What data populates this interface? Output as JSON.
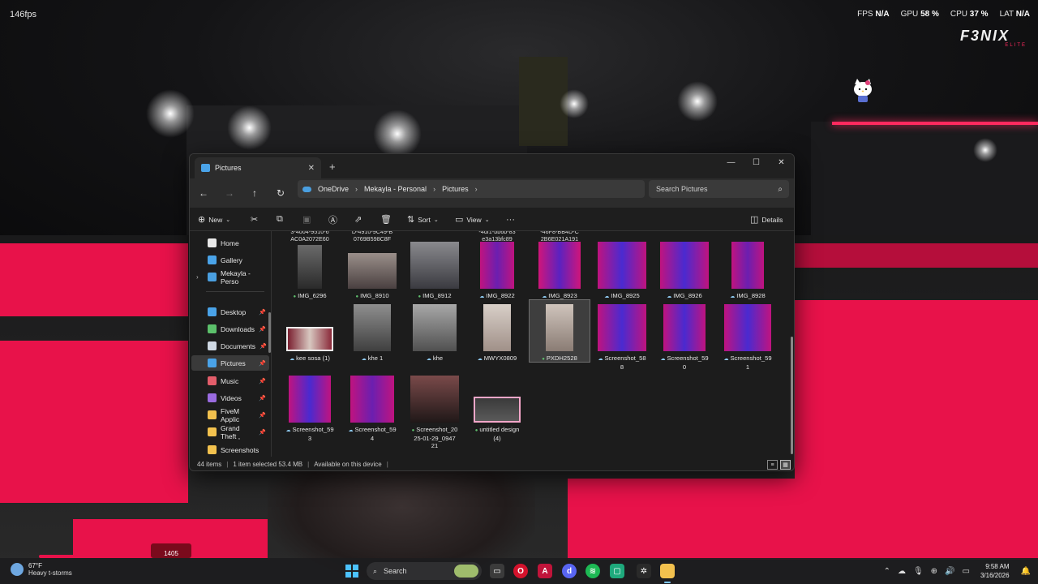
{
  "overlay": {
    "fps_counter": "146fps",
    "fps_label": "FPS",
    "fps_value": "N/A",
    "gpu_label": "GPU",
    "gpu_value": "58 %",
    "cpu_label": "CPU",
    "cpu_value": "37 %",
    "lat_label": "LAT",
    "lat_value": "N/A",
    "brand": "F3NIX",
    "brand_sub": "ELITE"
  },
  "window": {
    "tab_title": "Pictures",
    "breadcrumb": [
      "OneDrive",
      "Mekayla - Personal",
      "Pictures"
    ],
    "search_placeholder": "Search Pictures",
    "toolbar": {
      "new": "New",
      "sort": "Sort",
      "view": "View",
      "details": "Details"
    },
    "sidebar": [
      {
        "label": "Home",
        "icon": "home-icon",
        "color": "#e8e8e8"
      },
      {
        "label": "Gallery",
        "icon": "gallery-icon",
        "color": "#4aa3e8"
      },
      {
        "label": "Mekayla - Perso",
        "icon": "onedrive-icon",
        "color": "#4a9fe0"
      },
      {
        "label": "Desktop",
        "icon": "desktop-icon",
        "color": "#4aa3e8"
      },
      {
        "label": "Downloads",
        "icon": "downloads-icon",
        "color": "#5cc06b"
      },
      {
        "label": "Documents",
        "icon": "documents-icon",
        "color": "#cfd8e3"
      },
      {
        "label": "Pictures",
        "icon": "pictures-icon",
        "color": "#4aa3e8"
      },
      {
        "label": "Music",
        "icon": "music-icon",
        "color": "#e35d6a"
      },
      {
        "label": "Videos",
        "icon": "videos-icon",
        "color": "#9a6be0"
      },
      {
        "label": "FiveM Applic",
        "icon": "folder-icon",
        "color": "#f2c14e"
      },
      {
        "label": "Grand Theft ,",
        "icon": "folder-icon",
        "color": "#f2c14e"
      },
      {
        "label": "Screenshots",
        "icon": "folder-icon",
        "color": "#f2c14e"
      }
    ],
    "partial_names": [
      "3-4004-9510-6\nAC0A2072E60",
      "D-4910-9C49-B\n0769B598C8F",
      "-4df1-bb6b-83\ne3a13bfc89",
      "-46F8-BB4D-C\n2B6E021A191"
    ],
    "files": [
      {
        "name": "IMG_6296",
        "status": "ok"
      },
      {
        "name": "IMG_8910",
        "status": "ok"
      },
      {
        "name": "IMG_8912",
        "status": "ok"
      },
      {
        "name": "IMG_8922",
        "status": "cloud"
      },
      {
        "name": "IMG_8923",
        "status": "cloud"
      },
      {
        "name": "IMG_8925",
        "status": "cloud"
      },
      {
        "name": "IMG_8926",
        "status": "cloud"
      },
      {
        "name": "IMG_8928",
        "status": "cloud"
      },
      {
        "name": "kee sosa (1)",
        "status": "cloud"
      },
      {
        "name": "khe 1",
        "status": "cloud"
      },
      {
        "name": "khe",
        "status": "cloud"
      },
      {
        "name": "MWYX0809",
        "status": "cloud"
      },
      {
        "name": "PXDH2528",
        "status": "ok"
      },
      {
        "name": "Screenshot_58\n8",
        "status": "cloud"
      },
      {
        "name": "Screenshot_59\n0",
        "status": "cloud"
      },
      {
        "name": "Screenshot_59\n1",
        "status": "cloud"
      },
      {
        "name": "Screenshot_59\n3",
        "status": "cloud"
      },
      {
        "name": "Screenshot_59\n4",
        "status": "cloud"
      },
      {
        "name": "Screenshot_20\n25-01-29_0947\n21",
        "status": "ok"
      },
      {
        "name": "untitled design\n(4)",
        "status": "ok"
      }
    ],
    "status": {
      "count": "44 items",
      "selected": "1 item selected  53.4 MB",
      "availability": "Available on this device"
    }
  },
  "taskbar": {
    "temp": "67°F",
    "weather": "Heavy t-storms",
    "search": "Search",
    "time": "9:58 AM",
    "date": "3/16/2026",
    "hud_value": "1405"
  }
}
